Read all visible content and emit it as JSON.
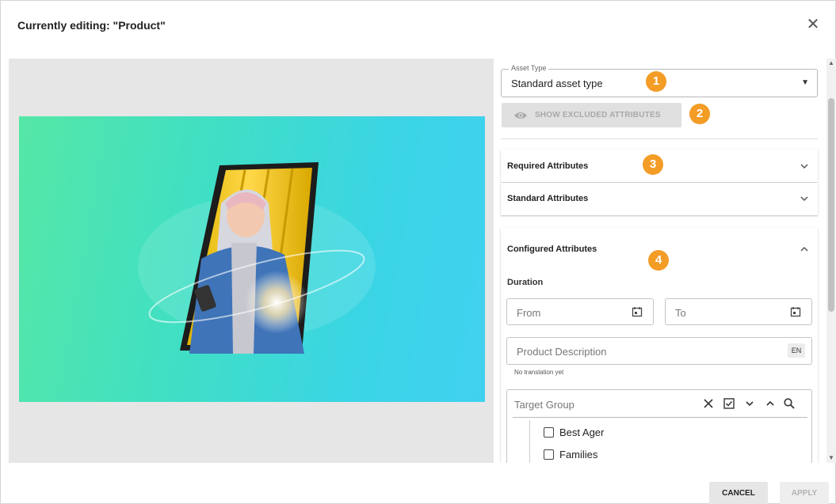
{
  "dialog": {
    "title": "Currently editing: \"Product\"",
    "close_icon": "close-icon"
  },
  "preview": {
    "image_icon": "smartphone-woman-illustration"
  },
  "asset_type": {
    "label": "Asset Type",
    "value": "Standard asset type"
  },
  "exclude_button": {
    "label": "SHOW EXCLUDED ATTRIBUTES",
    "icon": "eye-icon"
  },
  "badges": [
    "1",
    "2",
    "3",
    "4"
  ],
  "sections": {
    "required": {
      "title": "Required Attributes"
    },
    "standard": {
      "title": "Standard Attributes"
    },
    "configured": {
      "title": "Configured Attributes"
    }
  },
  "configured": {
    "duration_label": "Duration",
    "from_placeholder": "From",
    "to_placeholder": "To",
    "description_placeholder": "Product Description",
    "language": "EN",
    "translation_hint": "No translation yet",
    "target_group_placeholder": "Target Group",
    "target_group_items": [
      "Best Ager",
      "Families"
    ]
  },
  "footer": {
    "cancel": "CANCEL",
    "apply": "APPLY"
  },
  "colors": {
    "badge": "#f39c26",
    "image_gradient_start": "#55e7a6",
    "image_gradient_end": "#41d1f0"
  }
}
